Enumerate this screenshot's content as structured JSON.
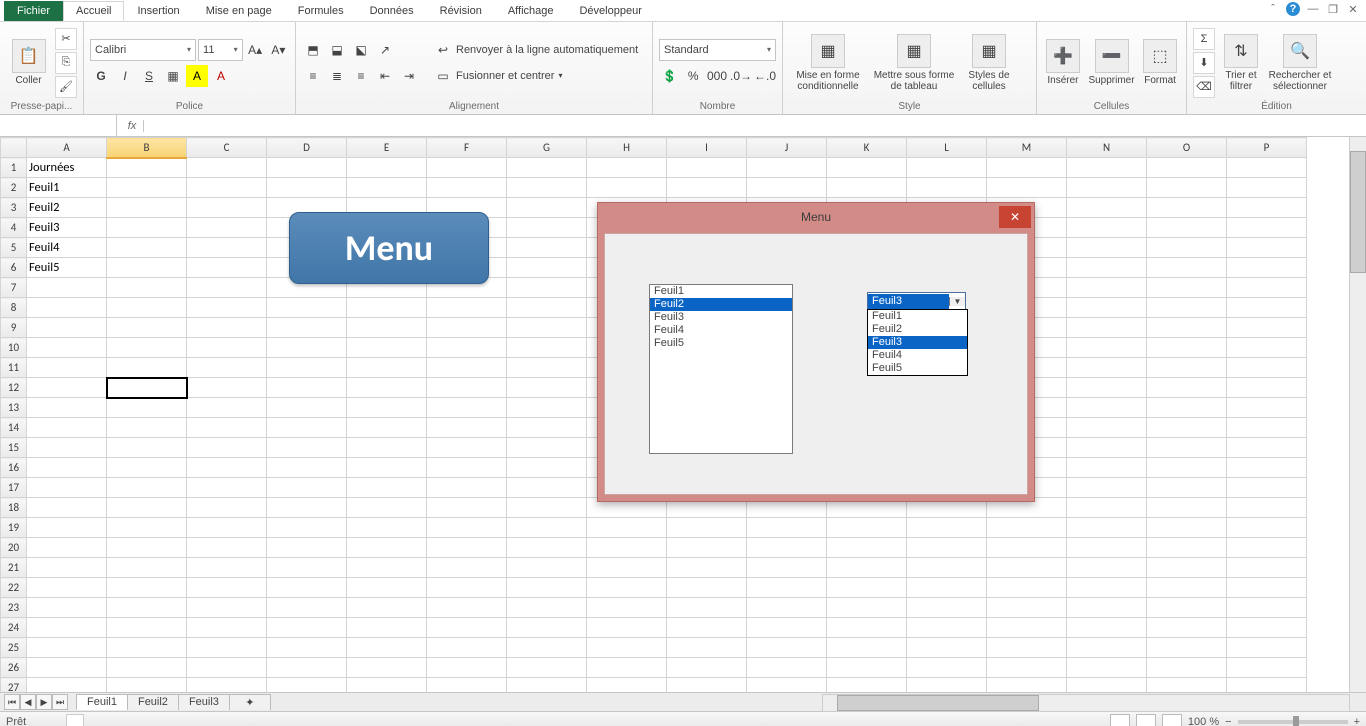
{
  "tabs": {
    "file": "Fichier",
    "items": [
      "Accueil",
      "Insertion",
      "Mise en page",
      "Formules",
      "Données",
      "Révision",
      "Affichage",
      "Développeur"
    ],
    "active": 0
  },
  "ribbon": {
    "clipboard": {
      "title": "Presse-papi...",
      "paste": "Coller"
    },
    "font": {
      "title": "Police",
      "name": "Calibri",
      "size": "11",
      "bold": "G",
      "italic": "I",
      "underline": "S"
    },
    "align": {
      "title": "Alignement",
      "wrap": "Renvoyer à la ligne automatiquement",
      "merge": "Fusionner et centrer"
    },
    "number": {
      "title": "Nombre",
      "format": "Standard"
    },
    "style": {
      "title": "Style",
      "condfmt": "Mise en forme conditionnelle",
      "table": "Mettre sous forme de tableau",
      "cellstyle": "Styles de cellules"
    },
    "cells": {
      "title": "Cellules",
      "insert": "Insérer",
      "delete": "Supprimer",
      "format": "Format"
    },
    "editing": {
      "title": "Édition",
      "sort": "Trier et filtrer",
      "find": "Rechercher et sélectionner"
    }
  },
  "namebox": "",
  "columns": [
    "A",
    "B",
    "C",
    "D",
    "E",
    "F",
    "G",
    "H",
    "I",
    "J",
    "K",
    "L",
    "M",
    "N",
    "O",
    "P"
  ],
  "rows": 27,
  "cells": {
    "A1": "Journées",
    "A2": "Feuil1",
    "A3": "Feuil2",
    "A4": "Feuil3",
    "A5": "Feuil4",
    "A6": "Feuil5"
  },
  "selected_col": "B",
  "selected_cell": "B12",
  "menu_shape": "Menu",
  "userform": {
    "title": "Menu",
    "list": [
      "Feuil1",
      "Feuil2",
      "Feuil3",
      "Feuil4",
      "Feuil5"
    ],
    "list_selected": 1,
    "combo_value": "Feuil3",
    "combo_options": [
      "Feuil1",
      "Feuil2",
      "Feuil3",
      "Feuil4",
      "Feuil5"
    ],
    "combo_selected": 2
  },
  "sheet_tabs": [
    "Feuil1",
    "Feuil2",
    "Feuil3"
  ],
  "sheet_active": 0,
  "status": {
    "ready": "Prêt",
    "zoom": "100 %"
  }
}
